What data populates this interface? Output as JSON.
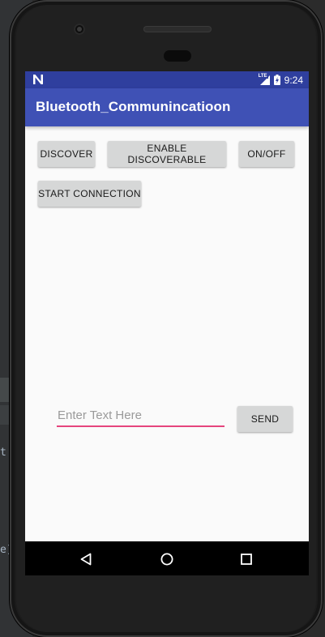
{
  "ide": {
    "fragments": [
      "t i",
      "e)"
    ]
  },
  "status_bar": {
    "network_type": "LTE",
    "time": "9:24",
    "icons": [
      "n-notification-icon",
      "lte-signal-icon",
      "battery-charging-icon"
    ]
  },
  "app_bar": {
    "title": "Bluetooth_Communincatioon"
  },
  "buttons": {
    "discover": "DISCOVER",
    "enable_discoverable": "ENABLE DISCOVERABLE",
    "on_off": "ON/OFF",
    "start_connection": "START CONNECTION",
    "send": "SEND"
  },
  "message_input": {
    "value": "",
    "placeholder": "Enter Text Here"
  },
  "nav_bar": {
    "icons": [
      "back-icon",
      "home-icon",
      "recents-icon"
    ]
  },
  "colors": {
    "status_bar": "#2f3f9e",
    "app_bar": "#3f51b5",
    "accent": "#e5457d",
    "button": "#d6d7d7",
    "screen_background": "#fafafa"
  }
}
